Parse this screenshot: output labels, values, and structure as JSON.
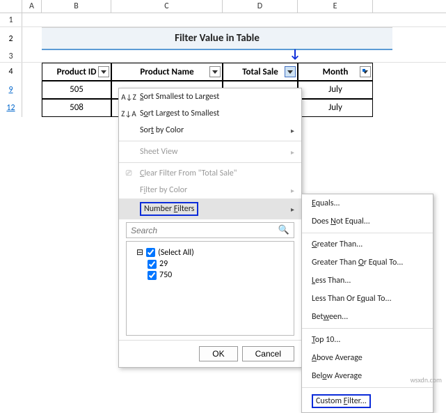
{
  "columns": [
    "A",
    "B",
    "C",
    "D",
    "E"
  ],
  "title": "Filter Value in Table",
  "headers": {
    "b": "Product ID",
    "c": "Product Name",
    "d": "Total Sale",
    "e": "Month"
  },
  "rows": {
    "title_row": "2",
    "blank_row": "3",
    "header_row": "4",
    "r9": "9",
    "r12": "12"
  },
  "data": [
    {
      "row": "9",
      "product_id": "505",
      "month": "July"
    },
    {
      "row": "12",
      "product_id": "508",
      "month": "July"
    }
  ],
  "menu": {
    "sort_asc": "Sort Smallest to Largest",
    "sort_desc": "Sort Largest to Smallest",
    "sort_color": "Sort by Color",
    "sheet_view": "Sheet View",
    "clear": "Clear Filter From \"Total Sale\"",
    "filter_color": "Filter by Color",
    "number_filters": "Number Filters",
    "search_placeholder": "Search",
    "select_all": "(Select All)",
    "opt1": "29",
    "opt2": "750",
    "ok": "OK",
    "cancel": "Cancel",
    "icon_asc": "A↓Z",
    "icon_desc": "Z↓A"
  },
  "submenu": {
    "equals": "Equals...",
    "not_equal": "Does Not Equal...",
    "gt": "Greater Than...",
    "gte": "Greater Than Or Equal To...",
    "lt": "Less Than...",
    "lte": "Less Than Or Equal To...",
    "between": "Between...",
    "top10": "Top 10...",
    "above_avg": "Above Average",
    "below_avg": "Below Average",
    "custom": "Custom Filter..."
  },
  "watermark": "wsxdn.com"
}
